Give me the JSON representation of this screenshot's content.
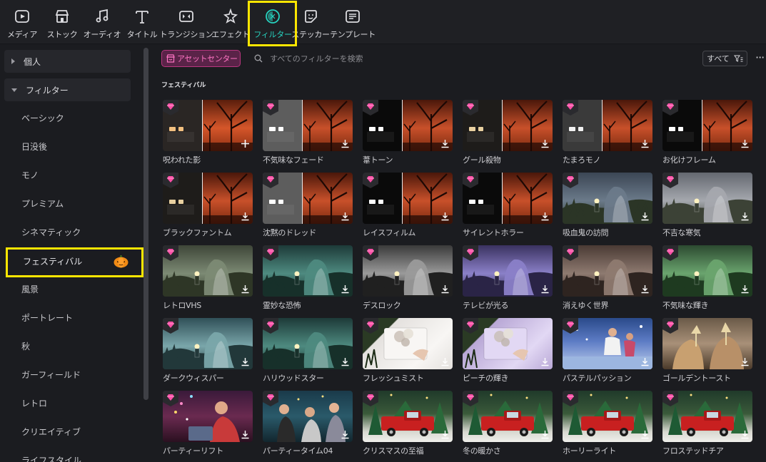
{
  "toolbar": {
    "items": [
      {
        "label": "メディア",
        "icon": "media-icon"
      },
      {
        "label": "ストック",
        "icon": "stock-icon"
      },
      {
        "label": "オーディオ",
        "icon": "audio-icon"
      },
      {
        "label": "タイトル",
        "icon": "title-icon"
      },
      {
        "label": "トランジション",
        "icon": "transition-icon"
      },
      {
        "label": "エフェクト",
        "icon": "effect-icon"
      },
      {
        "label": "フィルター",
        "icon": "filter-icon",
        "active": true
      },
      {
        "label": "ステッカー",
        "icon": "sticker-icon"
      },
      {
        "label": "テンプレート",
        "icon": "template-icon"
      }
    ]
  },
  "sidebar": {
    "groups": [
      {
        "label": "個人",
        "expanded": false
      },
      {
        "label": "フィルター",
        "expanded": true
      }
    ],
    "items": [
      {
        "label": "ベーシック"
      },
      {
        "label": "日没後"
      },
      {
        "label": "モノ"
      },
      {
        "label": "プレミアム"
      },
      {
        "label": "シネマティック"
      },
      {
        "label": "フェスティバル",
        "selected": true,
        "badge": "pumpkin-icon"
      },
      {
        "label": "風景"
      },
      {
        "label": "ポートレート"
      },
      {
        "label": "秋"
      },
      {
        "label": "ガーフィールド"
      },
      {
        "label": "レトロ"
      },
      {
        "label": "クリエイティブ"
      },
      {
        "label": "ライフスタイル"
      }
    ]
  },
  "main": {
    "asset_center": "アセットセンター",
    "search_placeholder": "すべてのフィルターを検索",
    "filter_select": "すべて",
    "more": "···",
    "section_title": "フェスティバル",
    "filters": [
      {
        "label": "呪われた影",
        "style": "split-orange",
        "action": "add"
      },
      {
        "label": "不気味なフェード",
        "style": "split-grey",
        "action": "download"
      },
      {
        "label": "葦トーン",
        "style": "split-black",
        "action": "download"
      },
      {
        "label": "グール殺物",
        "style": "split-dark",
        "action": "download"
      },
      {
        "label": "たまろモノ",
        "style": "split-mono",
        "action": "download"
      },
      {
        "label": "お化けフレーム",
        "style": "split-black",
        "action": "download"
      },
      {
        "label": "ブラックファントム",
        "style": "split-dark",
        "action": "download"
      },
      {
        "label": "沈黙のドレッド",
        "style": "split-grey",
        "action": "download"
      },
      {
        "label": "レイスフィルム",
        "style": "split-black",
        "action": "download"
      },
      {
        "label": "サイレントホラー",
        "style": "split-black",
        "action": "download"
      },
      {
        "label": "吸血鬼の訪問",
        "style": "ghost-blue",
        "action": "download"
      },
      {
        "label": "不吉な寒気",
        "style": "ghost-grey",
        "action": "download"
      },
      {
        "label": "レトロVHS",
        "style": "ghost-olive",
        "action": "download"
      },
      {
        "label": "霊妙な恐怖",
        "style": "ghost-teal",
        "action": "download"
      },
      {
        "label": "デスロック",
        "style": "ghost-bw",
        "action": "download"
      },
      {
        "label": "テレビが光る",
        "style": "ghost-purple",
        "action": "download"
      },
      {
        "label": "消えゆく世界",
        "style": "ghost-brown",
        "action": "download"
      },
      {
        "label": "不気味な輝き",
        "style": "ghost-green",
        "action": "download"
      },
      {
        "label": "ダークウィスパー",
        "style": "ghost-cyan",
        "action": "download"
      },
      {
        "label": "ハリウッドスター",
        "style": "ghost-teal",
        "action": "download"
      },
      {
        "label": "フレッシュミスト",
        "style": "gift-white",
        "action": "download"
      },
      {
        "label": "ピーチの輝き",
        "style": "gift-violet",
        "action": "download"
      },
      {
        "label": "パステルパッション",
        "style": "party-blue",
        "action": "download"
      },
      {
        "label": "ゴールデントースト",
        "style": "party-gold",
        "action": "download"
      },
      {
        "label": "パーティーリフト",
        "style": "party-lights",
        "action": "download"
      },
      {
        "label": "パーティータイム04",
        "style": "party-teal",
        "action": "download"
      },
      {
        "label": "クリスマスの至福",
        "style": "xmas",
        "action": "download"
      },
      {
        "label": "冬の暖かさ",
        "style": "xmas",
        "action": "download"
      },
      {
        "label": "ホーリーライト",
        "style": "xmas",
        "action": "download"
      },
      {
        "label": "フロステッドチア",
        "style": "xmas",
        "action": "download"
      }
    ]
  }
}
